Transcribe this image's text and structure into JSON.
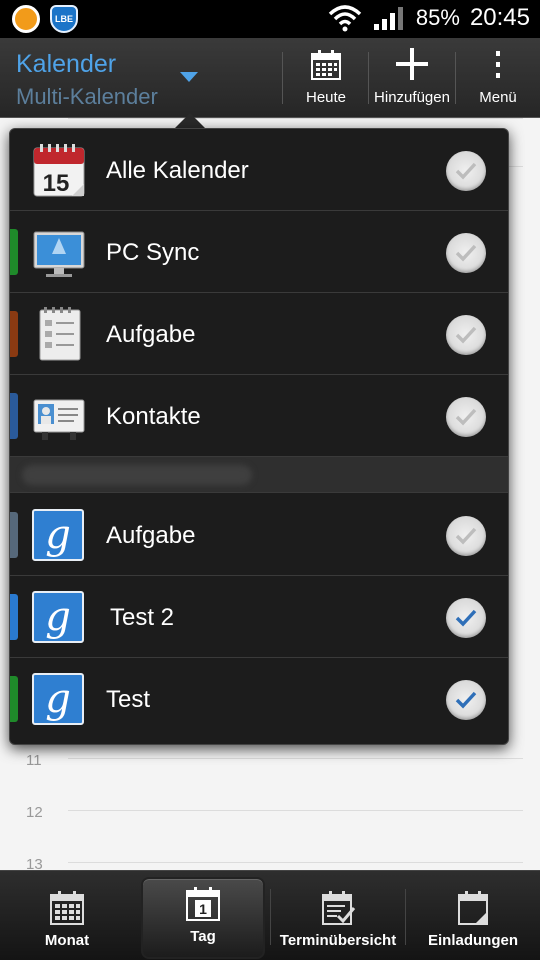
{
  "status_bar": {
    "battery": "85%",
    "time": "20:45",
    "notif_icons": [
      "app-notification-icon",
      "lbe-security-icon"
    ],
    "lbe_label": "LBE"
  },
  "action_bar": {
    "title": "Kalender",
    "subtitle": "Multi-Kalender",
    "buttons": [
      {
        "label": "Heute",
        "icon": "calendar-grid-icon"
      },
      {
        "label": "Hinzufügen",
        "icon": "plus-icon"
      },
      {
        "label": "Menü",
        "icon": "overflow-menu-icon"
      }
    ]
  },
  "day_view": {
    "hours": [
      "11",
      "12",
      "13"
    ]
  },
  "calendar_list": {
    "items": [
      {
        "label": "Alle Kalender",
        "icon": "calendar-15-icon",
        "color": "",
        "checked": false,
        "date_number": "15"
      },
      {
        "label": "PC Sync",
        "icon": "pc-sync-icon",
        "color": "#1f8a2a",
        "checked": false
      },
      {
        "label": "Aufgabe",
        "icon": "tasks-notepad-icon",
        "color": "#8a3a12",
        "checked": false
      },
      {
        "label": "Kontakte",
        "icon": "contacts-card-icon",
        "color": "#2a5a9a",
        "checked": false
      },
      {
        "label": "Aufgabe",
        "icon": "google-icon",
        "color": "#56687a",
        "checked": false
      },
      {
        "label": "Test 2",
        "icon": "google-icon",
        "color": "#2a7ad0",
        "checked": true
      },
      {
        "label": "Test",
        "icon": "google-icon",
        "color": "#1f8a2a",
        "checked": true
      }
    ],
    "google_glyph": "g"
  },
  "bottom_nav": {
    "items": [
      {
        "label": "Monat",
        "icon": "month-grid-icon",
        "active": false
      },
      {
        "label": "Tag",
        "icon": "day-calendar-icon",
        "active": true,
        "day_number": "1"
      },
      {
        "label": "Terminübersicht",
        "icon": "agenda-icon",
        "active": false
      },
      {
        "label": "Einladungen",
        "icon": "invitations-icon",
        "active": false
      }
    ]
  },
  "colors": {
    "accent": "#4fa3e8",
    "subtitle": "#5c7f9c",
    "check": "#2f6fb8"
  }
}
